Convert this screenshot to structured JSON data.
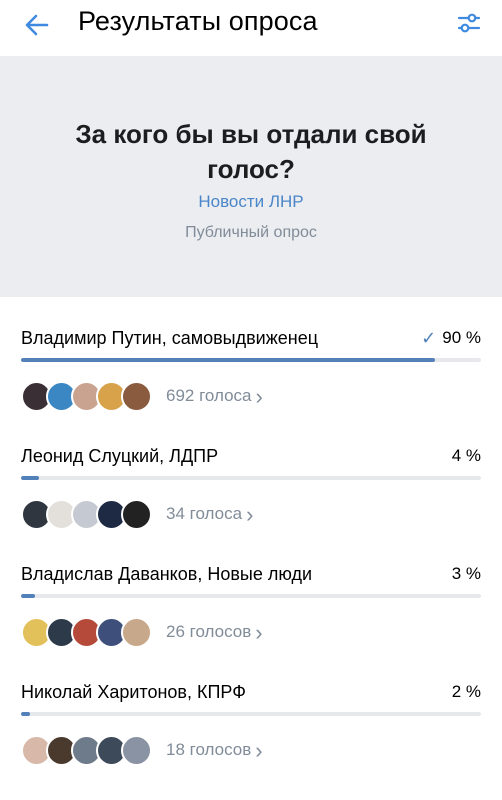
{
  "header": {
    "title": "Результаты опроса",
    "back_icon": "arrow-left-icon",
    "filter_icon": "sliders-icon",
    "accent": "#3f8ae0"
  },
  "poll": {
    "question": "За кого бы вы отдали свой голос?",
    "group": "Новости ЛНР",
    "type": "Публичный опрос"
  },
  "options": [
    {
      "label": "Владимир Путин, самовыдвиженец",
      "percent": "90 %",
      "fraction": 0.9,
      "voted": true,
      "votes": "692 голоса",
      "avatars": [
        "#3b2f36",
        "#3a87c4",
        "#c9a38f",
        "#d8a24a",
        "#8a5b3e"
      ]
    },
    {
      "label": "Леонид Слуцкий, ЛДПР",
      "percent": "4 %",
      "fraction": 0.04,
      "voted": false,
      "votes": "34 голоса",
      "avatars": [
        "#2f3640",
        "#e3e0dc",
        "#c5cad2",
        "#1e2a44",
        "#222222"
      ]
    },
    {
      "label": "Владислав Даванков, Новые люди",
      "percent": "3 %",
      "fraction": 0.03,
      "voted": false,
      "votes": "26 голосов",
      "avatars": [
        "#e2c15a",
        "#2d3a4a",
        "#b54a3a",
        "#3d4f7a",
        "#c7a88a"
      ]
    },
    {
      "label": "Николай Харитонов, КПРФ",
      "percent": "2 %",
      "fraction": 0.02,
      "voted": false,
      "votes": "18 голосов",
      "avatars": [
        "#d7b8a9",
        "#4a3a2e",
        "#6e7b8a",
        "#3c4a5a",
        "#8a93a3"
      ]
    }
  ]
}
